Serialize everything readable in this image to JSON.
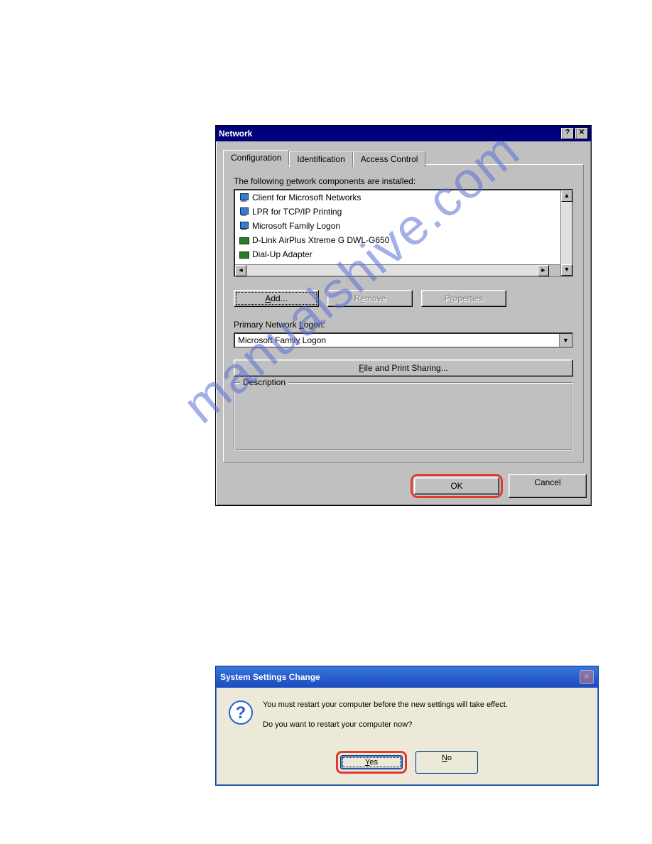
{
  "watermark": "manualshive.com",
  "network_dialog": {
    "title": "Network",
    "tabs": [
      "Configuration",
      "Identification",
      "Access Control"
    ],
    "list_label": "The following network components are installed:",
    "components": [
      {
        "icon": "pc",
        "label": "Client for Microsoft Networks"
      },
      {
        "icon": "pc",
        "label": "LPR for TCP/IP Printing"
      },
      {
        "icon": "pc",
        "label": "Microsoft Family Logon"
      },
      {
        "icon": "net",
        "label": "D-Link AirPlus Xtreme G DWL-G650"
      },
      {
        "icon": "net",
        "label": "Dial-Up Adapter"
      }
    ],
    "buttons": {
      "add": "Add...",
      "remove": "Remove",
      "properties": "Properties"
    },
    "primary_logon_label": "Primary Network Logon:",
    "primary_logon_value": "Microsoft Family Logon",
    "file_print_sharing": "File and Print Sharing...",
    "description_label": "Description",
    "ok": "OK",
    "cancel": "Cancel"
  },
  "restart_dialog": {
    "title": "System Settings Change",
    "line1": "You must restart your computer before the new settings will take effect.",
    "line2": "Do you want to restart your computer now?",
    "yes": "Yes",
    "no": "No"
  }
}
